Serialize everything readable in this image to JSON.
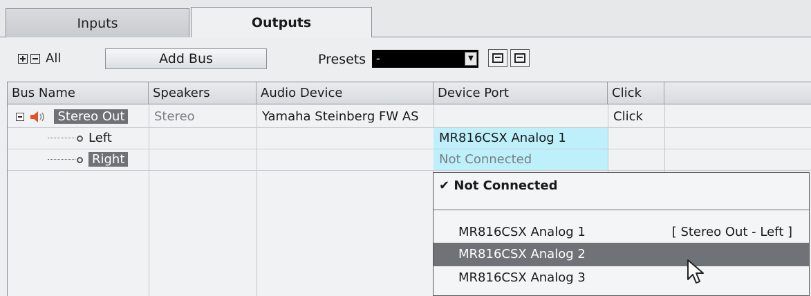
{
  "tabs": [
    {
      "label": "Inputs",
      "active": false
    },
    {
      "label": "Outputs",
      "active": true
    }
  ],
  "toolbar": {
    "all_label": "All",
    "add_bus_label": "Add Bus",
    "presets_label": "Presets",
    "presets_value": "-"
  },
  "table": {
    "headers": [
      "Bus Name",
      "Speakers",
      "Audio Device",
      "Device Port",
      "Click"
    ],
    "rows": [
      {
        "bus_name": "Stereo Out",
        "speakers": "Stereo",
        "audio_device": "Yamaha Steinberg FW AS",
        "device_port": "",
        "click": "Click"
      },
      {
        "bus_name": "Left",
        "speakers": "",
        "audio_device": "",
        "device_port": "MR816CSX Analog 1",
        "click": ""
      },
      {
        "bus_name": "Right",
        "speakers": "",
        "audio_device": "",
        "device_port": "Not Connected",
        "click": ""
      }
    ]
  },
  "dropdown": {
    "checked_item": "Not Connected",
    "items": [
      {
        "label": "MR816CSX Analog 1",
        "assignment": "[ Stereo Out - Left ]",
        "highlighted": false
      },
      {
        "label": "MR816CSX Analog 2",
        "assignment": "",
        "highlighted": true
      },
      {
        "label": "MR816CSX Analog 3",
        "assignment": "",
        "highlighted": false
      }
    ]
  },
  "colors": {
    "port_cell": "#bdf0fb",
    "selection": "#6e7176",
    "speaker_icon": "#e0522a"
  }
}
